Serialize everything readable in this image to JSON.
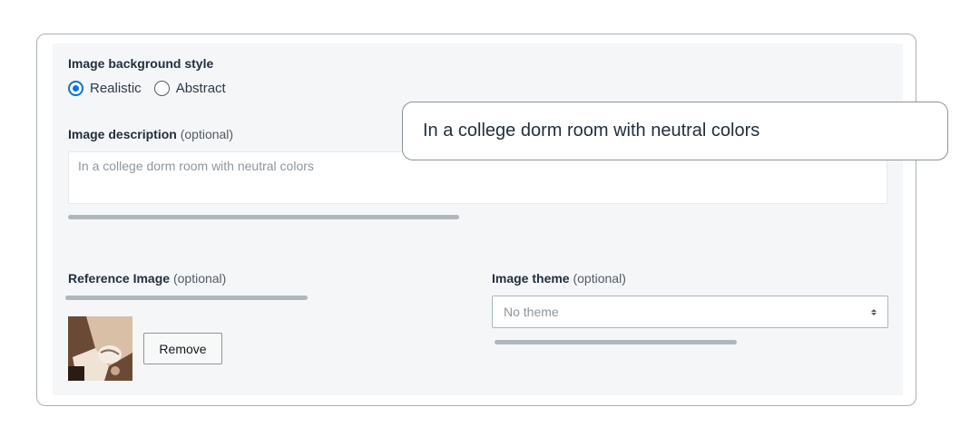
{
  "background_style": {
    "label": "Image background style",
    "options": [
      {
        "label": "Realistic",
        "checked": true
      },
      {
        "label": "Abstract",
        "checked": false
      }
    ]
  },
  "description": {
    "label": "Image description",
    "optional": "(optional)",
    "placeholder": "In a college dorm room with neutral colors"
  },
  "callout": {
    "text": "In a college dorm room with neutral colors"
  },
  "reference_image": {
    "label": "Reference Image",
    "optional": "(optional)",
    "remove_label": "Remove"
  },
  "image_theme": {
    "label": "Image theme",
    "optional": "(optional)",
    "selected": "No theme"
  },
  "colors": {
    "accent": "#0972d3",
    "panel_bg": "#f5f6f7",
    "border": "#a9b1b6"
  }
}
